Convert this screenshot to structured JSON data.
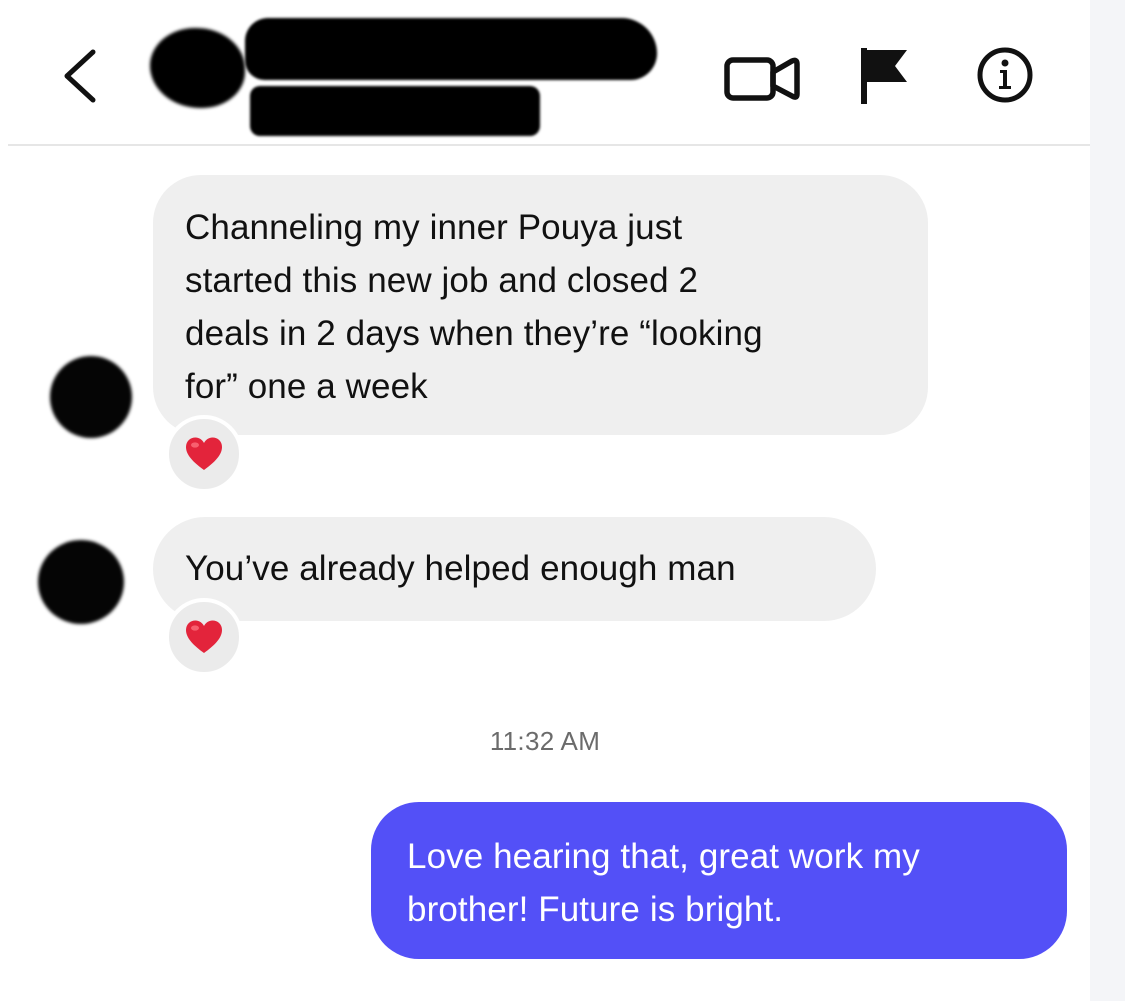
{
  "header": {
    "back_icon": "chevron-left-icon",
    "actions": [
      "video-camera-icon",
      "flag-icon",
      "info-icon"
    ]
  },
  "messages": [
    {
      "sender": "other",
      "lines": [
        "Channeling my inner Pouya just",
        "started this new job and closed 2",
        "deals in 2 days when they’re “looking",
        "for” one a week"
      ],
      "reaction": "❤️"
    },
    {
      "sender": "other",
      "lines": [
        "You’ve already helped enough man"
      ],
      "reaction": "❤️"
    },
    {
      "sender": "me",
      "lines": [
        "Love hearing that, great work my",
        "brother! Future is bright."
      ]
    }
  ],
  "timestamp": "11:32 AM",
  "colors": {
    "incoming_bubble": "#efefef",
    "outgoing_bubble": "#5350f7",
    "reaction_heart": "#e3243b",
    "redaction": "#000000"
  }
}
